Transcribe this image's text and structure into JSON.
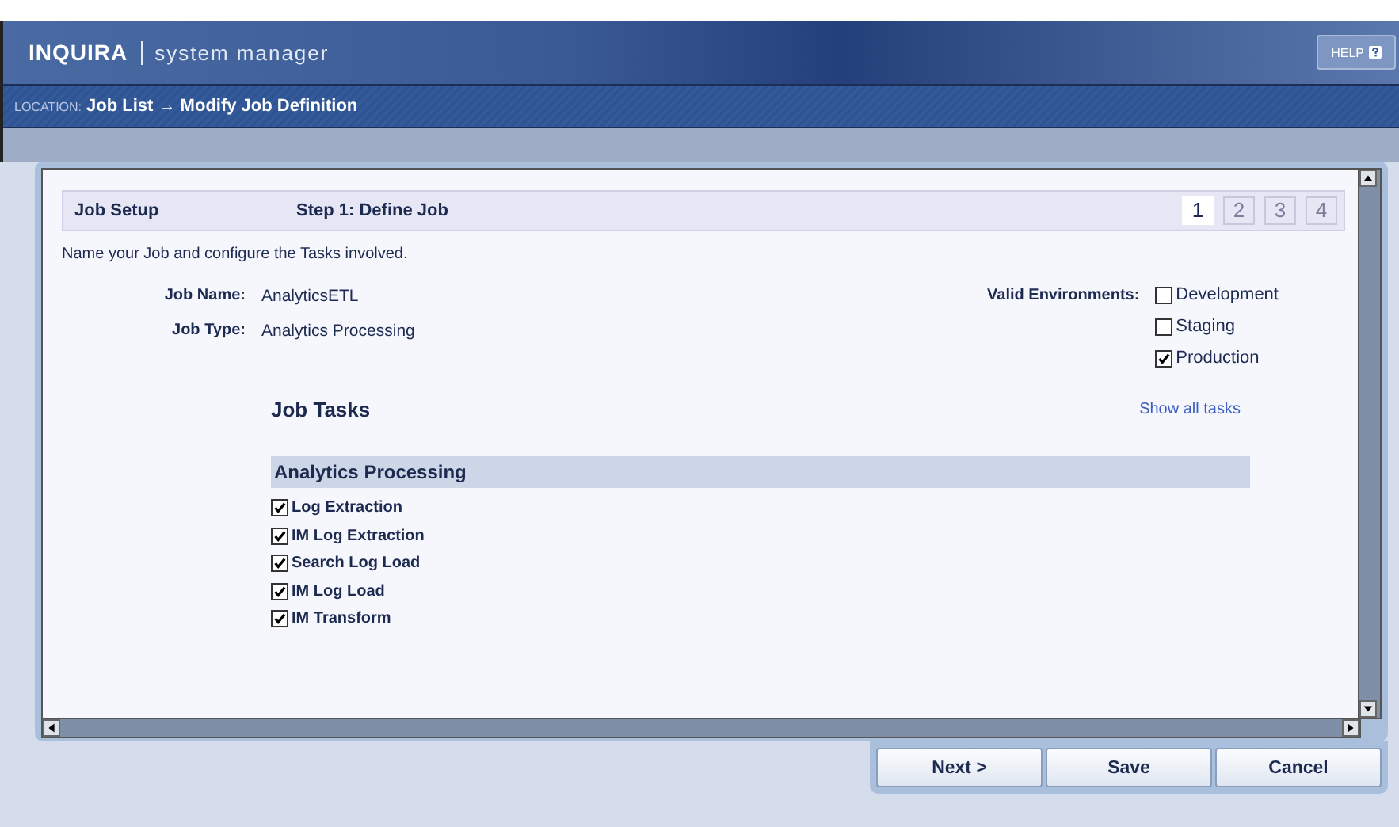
{
  "header": {
    "logo": "INQUIRA",
    "product": "system manager",
    "help": "HELP"
  },
  "location": {
    "label": "LOCATION:",
    "path": "Job List → Modify Job Definition"
  },
  "setup": {
    "title": "Job Setup",
    "step_title": "Step 1: Define Job",
    "steps": [
      {
        "label": "1",
        "selected": true
      },
      {
        "label": "2",
        "selected": false
      },
      {
        "label": "3",
        "selected": false
      },
      {
        "label": "4",
        "selected": false
      }
    ]
  },
  "intro": "Name your Job and configure the Tasks involved.",
  "fields": [
    {
      "label": "Job Name:",
      "value": "AnalyticsETL"
    },
    {
      "label": "Job Type:",
      "value": "Analytics Processing"
    }
  ],
  "environments": {
    "label": "Valid Environments:",
    "options": [
      {
        "label": "Development",
        "checked": false
      },
      {
        "label": "Staging",
        "checked": false
      },
      {
        "label": "Production",
        "checked": true
      }
    ]
  },
  "tasks": {
    "title": "Job Tasks",
    "link": "Show all tasks",
    "group": "Analytics Processing",
    "items": [
      {
        "label": "Log Extraction",
        "checked": true
      },
      {
        "label": "IM Log Extraction",
        "checked": true
      },
      {
        "label": "Search Log Load",
        "checked": true
      },
      {
        "label": "IM Log Load",
        "checked": true
      },
      {
        "label": "IM Transform",
        "checked": true
      }
    ]
  },
  "buttons": [
    "Next >",
    "Save",
    "Cancel"
  ]
}
